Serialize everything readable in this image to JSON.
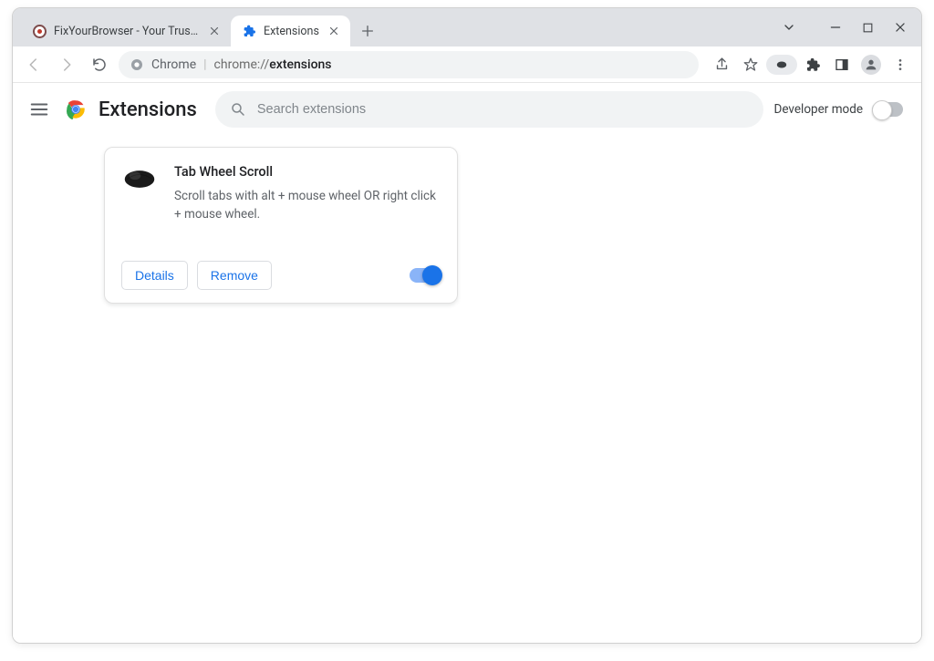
{
  "tabs": [
    {
      "title": "FixYourBrowser - Your Trusted So",
      "active": false
    },
    {
      "title": "Extensions",
      "active": true
    }
  ],
  "omnibox": {
    "scheme_label": "Chrome",
    "url_prefix": "chrome://",
    "url_bold": "extensions"
  },
  "page": {
    "title": "Extensions",
    "search_placeholder": "Search extensions",
    "dev_mode_label": "Developer mode"
  },
  "extension": {
    "name": "Tab Wheel Scroll",
    "description": "Scroll tabs with alt + mouse wheel OR right click + mouse wheel.",
    "details_label": "Details",
    "remove_label": "Remove",
    "enabled": true
  }
}
